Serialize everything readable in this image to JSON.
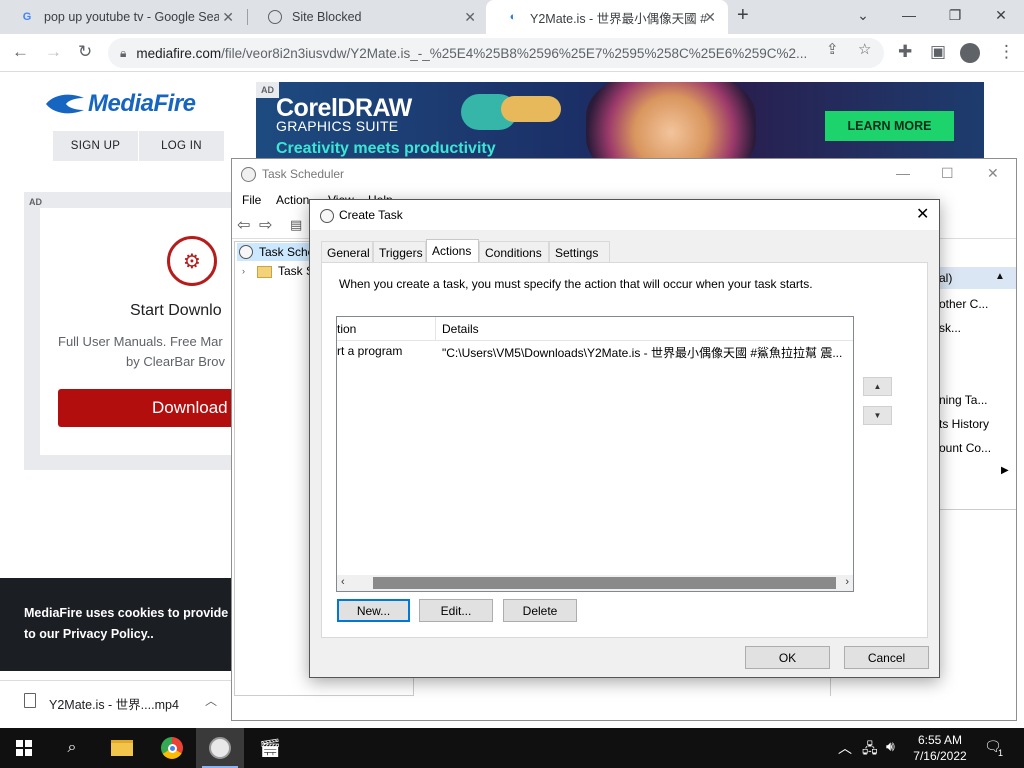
{
  "browser": {
    "tabs": [
      {
        "title": "pop up youtube tv - Google Sear",
        "favicon": "google-g-icon",
        "active": false
      },
      {
        "title": "Site Blocked",
        "favicon": "globe-icon",
        "active": false
      },
      {
        "title": "Y2Mate.is - 世界最小偶像天國 #",
        "favicon": "y2mate-icon",
        "active": true
      }
    ],
    "url_host": "mediafire.com",
    "url_path": "/file/veor8i2n3iusvdw/Y2Mate.is_-_%25E4%25B8%2596%25E7%2595%258C%25E6%259C%2..."
  },
  "mediafire": {
    "logo": "MediaFire",
    "sign_up": "SIGN UP",
    "log_in": "LOG IN",
    "banner_ad": {
      "tag": "AD",
      "title": "CorelDRAW",
      "subtitle": "GRAPHICS SUITE",
      "tagline": "Creativity meets productivity",
      "cta": "LEARN MORE"
    },
    "side_ad": {
      "tag": "AD",
      "heading": "Start Downlo",
      "line1": "Full User Manuals. Free Mar",
      "line2": "by ClearBar Brov",
      "button": "Download"
    },
    "cookie": {
      "line1": "MediaFire uses cookies to provide y",
      "line2": "to our Privacy Policy.."
    },
    "download_item": "Y2Mate.is - 世界....mp4"
  },
  "task_scheduler": {
    "title": "Task Scheduler",
    "menu": [
      "File",
      "Action",
      "View",
      "Help"
    ],
    "tree": [
      "Task Sche",
      "Task S"
    ],
    "actions_panel": {
      "header": "al)",
      "items": [
        "other C...",
        "sk...",
        "ning Ta...",
        "ts History",
        "ount Co..."
      ]
    }
  },
  "create_task": {
    "title": "Create Task",
    "tabs": [
      "General",
      "Triggers",
      "Actions",
      "Conditions",
      "Settings"
    ],
    "active_tab": "Actions",
    "description": "When you create a task, you must specify the action that will occur when your task starts.",
    "columns": [
      "tion",
      "Details"
    ],
    "rows": [
      {
        "action": "rt a program",
        "details": "\"C:\\Users\\VM5\\Downloads\\Y2Mate.is - 世界最小偶像天國 #鯊魚拉拉幫 震..."
      }
    ],
    "buttons": {
      "new": "New...",
      "edit": "Edit...",
      "delete": "Delete",
      "ok": "OK",
      "cancel": "Cancel"
    }
  },
  "taskbar": {
    "time": "6:55 AM",
    "date": "7/16/2022",
    "notification_count": "1"
  }
}
